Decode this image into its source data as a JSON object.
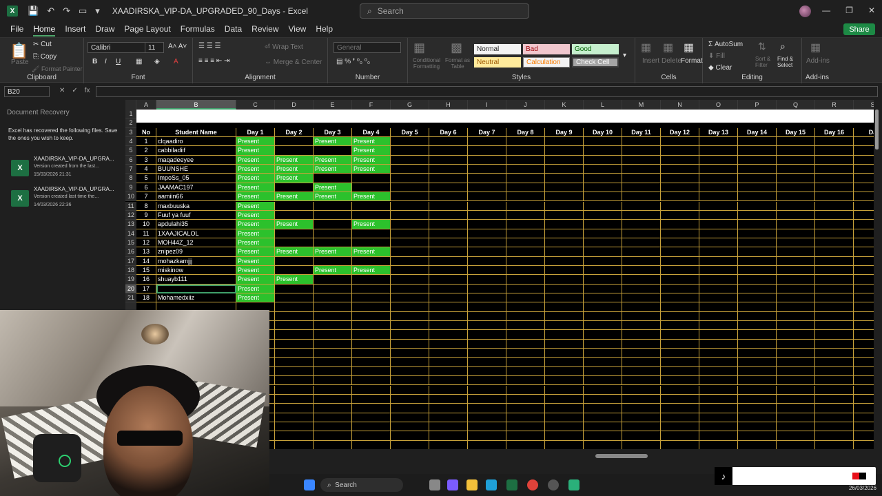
{
  "window": {
    "title": "XAADIRSKA_VIP-DA_UPGRADED_90_Days  -  Excel",
    "search_placeholder": "Search",
    "share_label": "Share"
  },
  "menu": [
    "File",
    "Home",
    "Insert",
    "Draw",
    "Page Layout",
    "Formulas",
    "Data",
    "Review",
    "View",
    "Help"
  ],
  "ribbon": {
    "clipboard": {
      "paste": "Paste",
      "cut": "Cut",
      "copy": "Copy",
      "format_painter": "Format Painter",
      "label": "Clipboard"
    },
    "font": {
      "name": "Calibri",
      "size": "11",
      "label": "Font"
    },
    "alignment": {
      "wrap": "Wrap Text",
      "merge": "Merge & Center",
      "label": "Alignment"
    },
    "number": {
      "format": "General",
      "label": "Number"
    },
    "styles": {
      "conditional": "Conditional Formatting",
      "format_table": "Format as Table",
      "normal": "Normal",
      "bad": "Bad",
      "good": "Good",
      "neutral": "Neutral",
      "calculation": "Calculation",
      "check_cell": "Check Cell",
      "label": "Styles"
    },
    "cells": {
      "insert": "Insert",
      "delete": "Delete",
      "format": "Format",
      "label": "Cells"
    },
    "editing": {
      "autosum": "AutoSum",
      "fill": "Fill",
      "clear": "Clear",
      "sort": "Sort & Filter",
      "find": "Find & Select",
      "label": "Editing"
    },
    "addins": {
      "label": "Add-ins",
      "button": "Add-ins"
    }
  },
  "formula_bar": {
    "namebox": "B20",
    "fx": "fx",
    "value": ""
  },
  "recovery": {
    "title": "Document Recovery",
    "message": "Excel has recovered the following files.  Save the ones you wish to keep.",
    "items": [
      {
        "name": "XAADIRSKA_VIP-DA_UPGRA...",
        "desc": "Version created from the last...",
        "time": "15/03/2026 21:31"
      },
      {
        "name": "XAADIRSKA_VIP-DA_UPGRA...",
        "desc": "Version created last time the...",
        "time": "14/03/2026 22:36"
      }
    ]
  },
  "sheet": {
    "columns": [
      "A",
      "B",
      "C",
      "D",
      "E",
      "F",
      "G",
      "H",
      "I",
      "J",
      "K",
      "L",
      "M",
      "N",
      "O",
      "P",
      "Q",
      "R",
      "S"
    ],
    "header_row": [
      "No",
      "Student Name",
      "Day 1",
      "Day 2",
      "Day 3",
      "Day 4",
      "Day 5",
      "Day 6",
      "Day 7",
      "Day 8",
      "Day 9",
      "Day 10",
      "Day 11",
      "Day 12",
      "Day 13",
      "Day 14",
      "Day 15",
      "Day 16",
      "Da"
    ],
    "present_label": "Present",
    "students": [
      {
        "no": "1",
        "name": "clqaadiro",
        "days": [
          1,
          0,
          1,
          1
        ]
      },
      {
        "no": "2",
        "name": "cabbiladiif",
        "days": [
          1,
          0,
          0,
          1
        ]
      },
      {
        "no": "3",
        "name": "maqadeeyee",
        "days": [
          1,
          1,
          1,
          1
        ]
      },
      {
        "no": "4",
        "name": "BUUNSHE",
        "days": [
          1,
          1,
          1,
          1
        ]
      },
      {
        "no": "5",
        "name": "ImpoSs_05",
        "days": [
          1,
          1,
          0,
          0
        ]
      },
      {
        "no": "6",
        "name": "JAAMAC197",
        "days": [
          1,
          0,
          1,
          0
        ]
      },
      {
        "no": "7",
        "name": "aamiin66",
        "days": [
          1,
          1,
          1,
          1
        ]
      },
      {
        "no": "8",
        "name": "maxbuuska",
        "days": [
          1,
          0,
          0,
          0
        ]
      },
      {
        "no": "9",
        "name": "Fuuf ya fuuf",
        "days": [
          1,
          0,
          0,
          0
        ]
      },
      {
        "no": "10",
        "name": "apdulahi35",
        "days": [
          1,
          1,
          0,
          1
        ]
      },
      {
        "no": "11",
        "name": "1XAAJICALOL",
        "days": [
          1,
          0,
          0,
          0
        ]
      },
      {
        "no": "12",
        "name": "MOH44Z_12",
        "days": [
          1,
          0,
          0,
          0
        ]
      },
      {
        "no": "13",
        "name": "znipez09",
        "days": [
          1,
          1,
          1,
          1
        ]
      },
      {
        "no": "14",
        "name": "mohazkamjjj",
        "days": [
          1,
          0,
          0,
          0
        ]
      },
      {
        "no": "15",
        "name": "miskinow",
        "days": [
          1,
          0,
          1,
          1
        ]
      },
      {
        "no": "16",
        "name": "shuayb111",
        "days": [
          1,
          1,
          0,
          0
        ]
      },
      {
        "no": "17",
        "name": "",
        "days": [
          1,
          0,
          0,
          0
        ]
      },
      {
        "no": "18",
        "name": "Mohamedxiiz",
        "days": [
          1,
          0,
          0,
          0
        ]
      }
    ],
    "row_numbers": [
      "1",
      "2",
      "3",
      "4",
      "5",
      "6",
      "7",
      "8",
      "9",
      "10",
      "11",
      "12",
      "13",
      "14",
      "15",
      "16",
      "17",
      "18",
      "19",
      "20",
      "21"
    ],
    "active_row": "20",
    "active_col": "B"
  },
  "taskbar": {
    "search": "Search",
    "date": "26/03/2026"
  }
}
